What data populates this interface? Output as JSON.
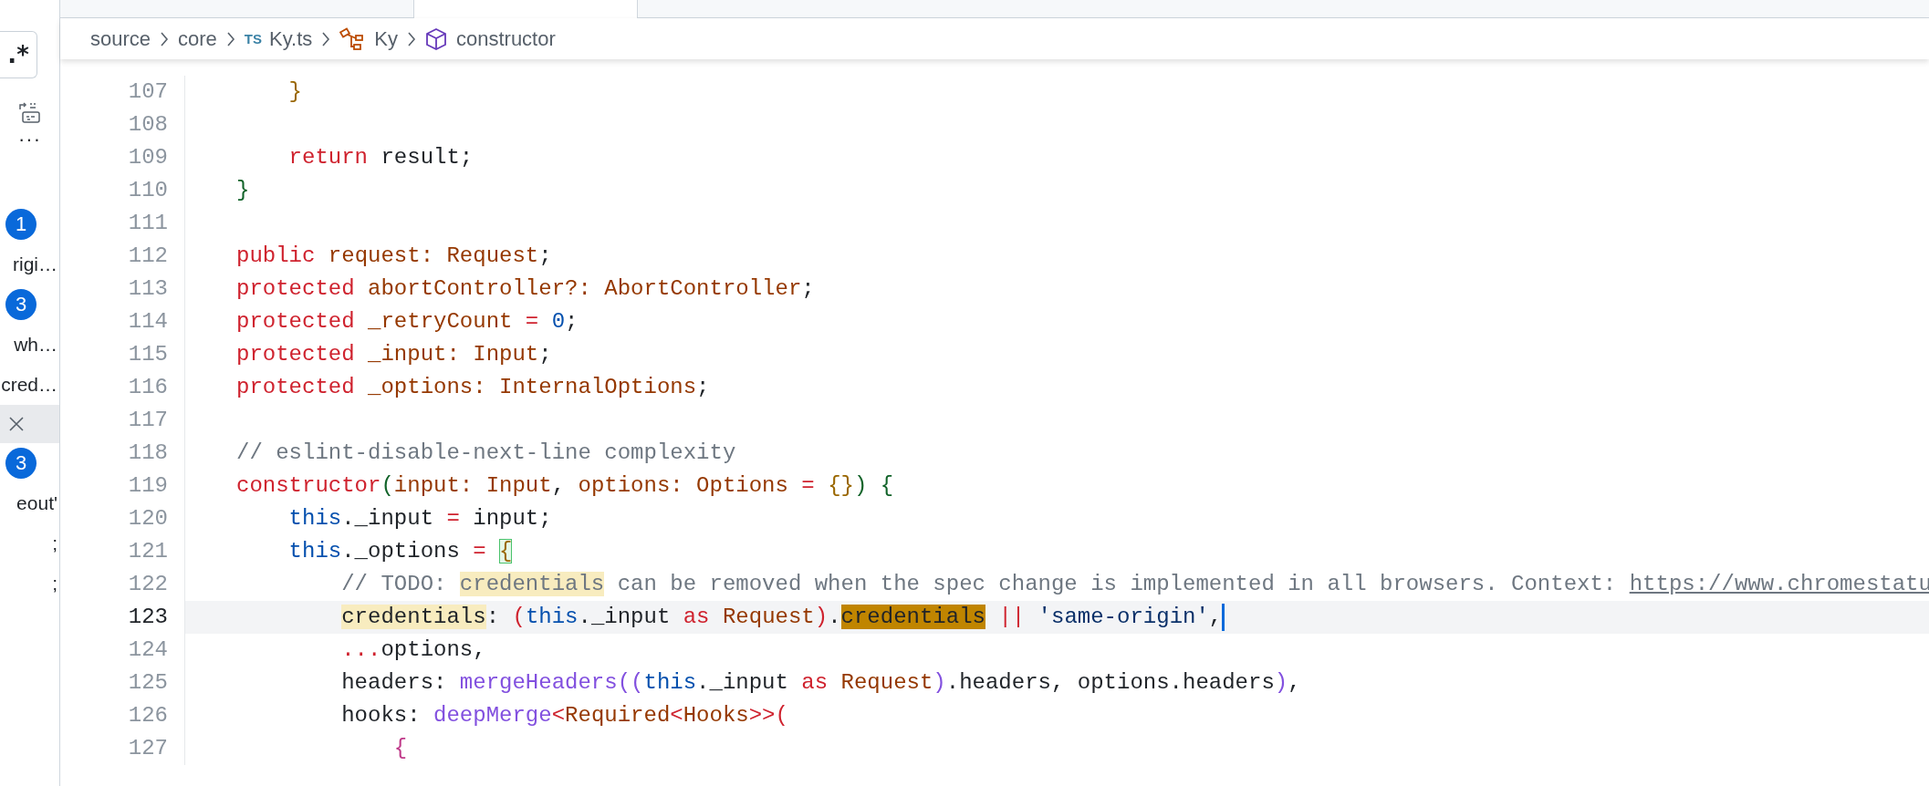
{
  "sidebar": {
    "items": [
      {
        "kind": "regex",
        "text": ".*",
        "selected": false
      },
      {
        "kind": "replace-all"
      },
      {
        "kind": "more",
        "text": "···"
      },
      {
        "kind": "badge",
        "text": "1"
      },
      {
        "kind": "text",
        "text": "rigi…"
      },
      {
        "kind": "badge",
        "text": "3"
      },
      {
        "kind": "text",
        "text": "wh…"
      },
      {
        "kind": "text",
        "text": "cred…"
      },
      {
        "kind": "close",
        "selected": true
      },
      {
        "kind": "badge",
        "text": "3"
      },
      {
        "kind": "text",
        "text": "eout'"
      },
      {
        "kind": "text",
        "text": ";"
      },
      {
        "kind": "text",
        "text": ";"
      }
    ]
  },
  "tabs": [
    {
      "selected": false
    },
    {
      "selected": true
    }
  ],
  "breadcrumb": [
    {
      "text": "source"
    },
    {
      "text": "core"
    },
    {
      "text": "Ky.ts",
      "kind": "file",
      "badge": "TS"
    },
    {
      "text": "Ky",
      "kind": "class"
    },
    {
      "text": "constructor",
      "kind": "method"
    }
  ],
  "editor": {
    "lines": [
      {
        "number": "107",
        "current": false,
        "tokens": [
          {
            "kind": "brace1",
            "text": "    }"
          }
        ]
      },
      {
        "number": "108",
        "current": false
      },
      {
        "number": "109",
        "current": false,
        "tokens": [
          {
            "kind": "kw",
            "text": "    return"
          },
          {
            "kind": "plain",
            "text": " result;"
          }
        ]
      },
      {
        "number": "110",
        "current": false,
        "tokens": [
          {
            "kind": "brace2",
            "text": "}"
          }
        ]
      },
      {
        "number": "111",
        "current": false
      },
      {
        "number": "112",
        "current": false,
        "tokens": [
          {
            "kind": "kw",
            "text": "public"
          },
          {
            "kind": "type",
            "text": " request: Request"
          },
          {
            "kind": "plain",
            "text": ";"
          }
        ]
      },
      {
        "number": "113",
        "current": false,
        "tokens": [
          {
            "kind": "kw",
            "text": "protected"
          },
          {
            "kind": "type",
            "text": " abortController?: AbortController"
          },
          {
            "kind": "plain",
            "text": ";"
          }
        ]
      },
      {
        "number": "114",
        "current": false,
        "tokens": [
          {
            "kind": "kw",
            "text": "protected"
          },
          {
            "kind": "type",
            "text": " _retryCount "
          },
          {
            "kind": "kw",
            "text": "="
          },
          {
            "kind": "num",
            "text": " 0"
          },
          {
            "kind": "plain",
            "text": ";"
          }
        ]
      },
      {
        "number": "115",
        "current": false,
        "tokens": [
          {
            "kind": "kw",
            "text": "protected"
          },
          {
            "kind": "type",
            "text": " _input: Input"
          },
          {
            "kind": "plain",
            "text": ";"
          }
        ]
      },
      {
        "number": "116",
        "current": false,
        "tokens": [
          {
            "kind": "kw",
            "text": "protected"
          },
          {
            "kind": "type",
            "text": " _options: InternalOptions"
          },
          {
            "kind": "plain",
            "text": ";"
          }
        ]
      },
      {
        "number": "117",
        "current": false
      },
      {
        "number": "118",
        "current": false,
        "tokens": [
          {
            "kind": "comment",
            "text": "// eslint-disable-next-line complexity"
          }
        ]
      },
      {
        "number": "119",
        "current": false,
        "tokens": [
          {
            "kind": "kw",
            "text": "constructor"
          },
          {
            "kind": "brace2",
            "text": "("
          },
          {
            "kind": "type",
            "text": "input: Input"
          },
          {
            "kind": "plain",
            "text": ", "
          },
          {
            "kind": "type",
            "text": "options: Options "
          },
          {
            "kind": "kw",
            "text": "= "
          },
          {
            "kind": "brace1",
            "text": "{}"
          },
          {
            "kind": "brace2",
            "text": ") {"
          }
        ]
      },
      {
        "number": "120",
        "current": false,
        "tokens": [
          {
            "kind": "this",
            "text": "    this"
          },
          {
            "kind": "plain",
            "text": "._input "
          },
          {
            "kind": "kw",
            "text": "="
          },
          {
            "kind": "plain",
            "text": " input;"
          }
        ]
      },
      {
        "number": "121",
        "current": false,
        "tokens": [
          {
            "kind": "this",
            "text": "    this"
          },
          {
            "kind": "plain",
            "text": "._options "
          },
          {
            "kind": "kw",
            "text": "= "
          },
          {
            "kind": "bracket-match",
            "text": "{"
          }
        ]
      },
      {
        "number": "122",
        "current": false,
        "tokens": [
          {
            "kind": "comment",
            "text": "        // TODO: "
          },
          {
            "kind": "comment-match",
            "text": "credentials"
          },
          {
            "kind": "comment",
            "text": " can be removed when the spec change is implemented in all browsers. Context: "
          },
          {
            "kind": "link",
            "text": "https://www.chromestatu"
          }
        ]
      },
      {
        "number": "123",
        "current": true,
        "tokens": [
          {
            "kind": "plain-match",
            "text": "        credentials"
          },
          {
            "kind": "plain",
            "text": ": "
          },
          {
            "kind": "kw",
            "text": "("
          },
          {
            "kind": "this",
            "text": "this"
          },
          {
            "kind": "plain",
            "text": "._input "
          },
          {
            "kind": "kw",
            "text": "as"
          },
          {
            "kind": "type",
            "text": " Request"
          },
          {
            "kind": "kw",
            "text": ")"
          },
          {
            "kind": "plain",
            "text": "."
          },
          {
            "kind": "current-match",
            "text": "credentials"
          },
          {
            "kind": "kw",
            "text": " ||"
          },
          {
            "kind": "str",
            "text": " 'same-origin'"
          },
          {
            "kind": "plain",
            "text": ","
          }
        ]
      },
      {
        "number": "124",
        "current": false,
        "tokens": [
          {
            "kind": "kw",
            "text": "        ..."
          },
          {
            "kind": "plain",
            "text": "options,"
          }
        ]
      },
      {
        "number": "125",
        "current": false,
        "tokens": [
          {
            "kind": "plain",
            "text": "        headers: "
          },
          {
            "kind": "fn",
            "text": "mergeHeaders"
          },
          {
            "kind": "brace3",
            "text": "(("
          },
          {
            "kind": "this",
            "text": "this"
          },
          {
            "kind": "plain",
            "text": "._input "
          },
          {
            "kind": "kw",
            "text": "as"
          },
          {
            "kind": "type",
            "text": " Request"
          },
          {
            "kind": "brace3",
            "text": ")"
          },
          {
            "kind": "plain",
            "text": ".headers, options.headers"
          },
          {
            "kind": "brace3",
            "text": ")"
          },
          {
            "kind": "plain",
            "text": ","
          }
        ]
      },
      {
        "number": "126",
        "current": false,
        "tokens": [
          {
            "kind": "plain",
            "text": "        hooks: "
          },
          {
            "kind": "fn",
            "text": "deepMerge"
          },
          {
            "kind": "kw",
            "text": "<"
          },
          {
            "kind": "type",
            "text": "Required"
          },
          {
            "kind": "kw",
            "text": "<"
          },
          {
            "kind": "type",
            "text": "Hooks"
          },
          {
            "kind": "kw",
            "text": ">>("
          }
        ]
      },
      {
        "number": "127",
        "current": false,
        "tokens": [
          {
            "kind": "brace4",
            "text": "            {"
          }
        ]
      }
    ]
  }
}
